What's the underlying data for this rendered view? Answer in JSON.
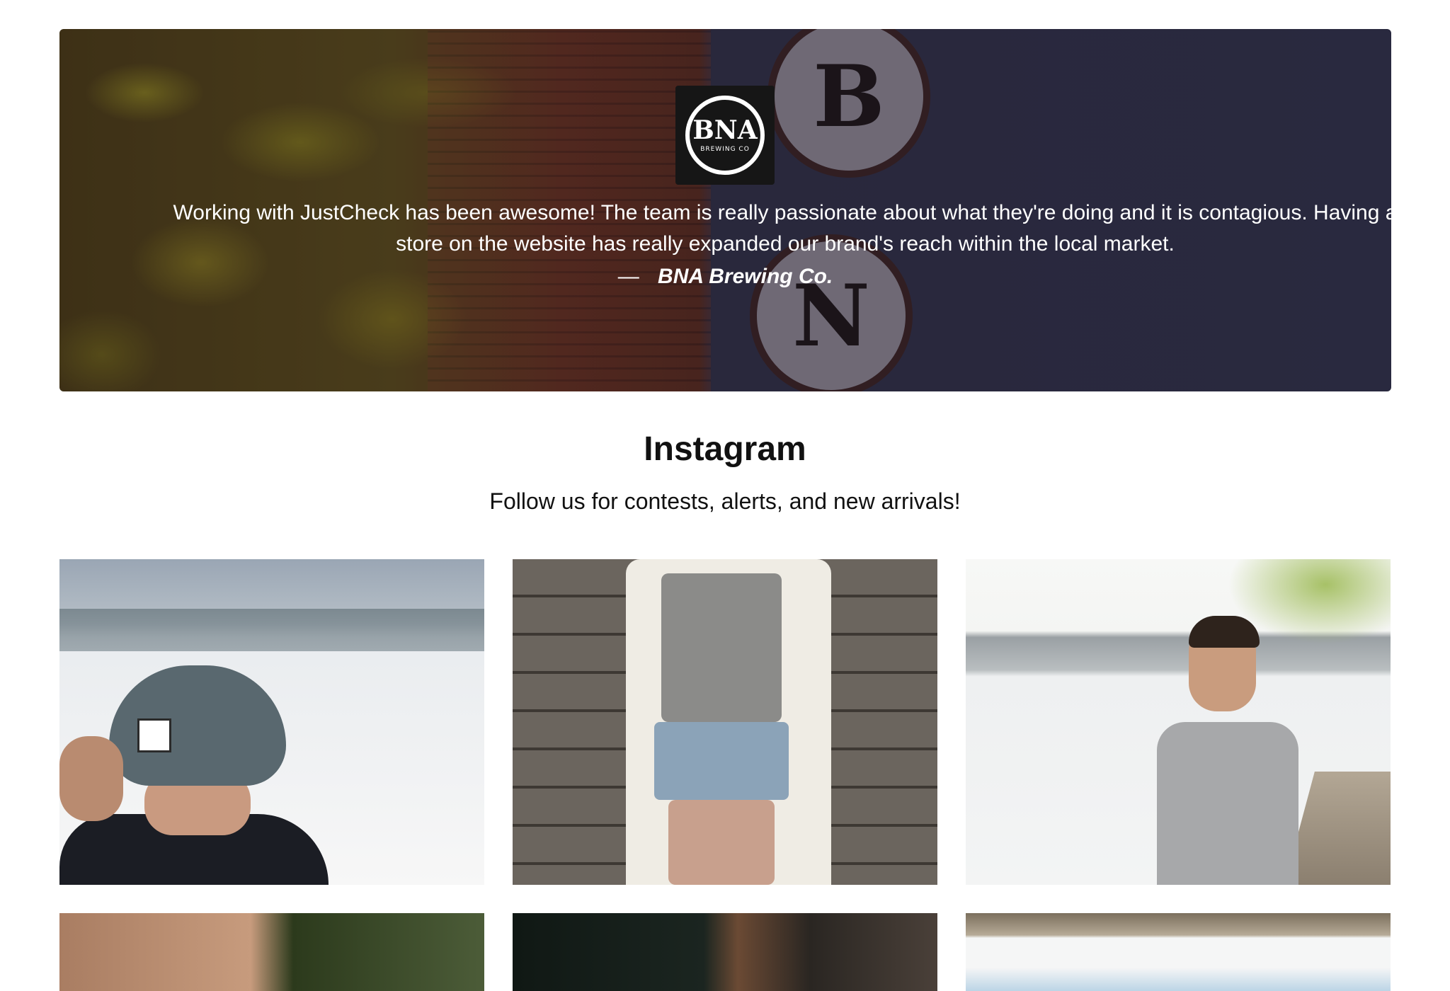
{
  "testimonial": {
    "logo": {
      "main": "BNA",
      "sub": "BREWING CO"
    },
    "sign_letters": [
      "B",
      "N"
    ],
    "quote": "Working with JustCheck has been awesome! The team is really passionate about what they're doing and it is contagious. Having a store on the website has really expanded our brand's reach within the local market.",
    "dash": "—",
    "author": "BNA Brewing Co."
  },
  "instagram": {
    "title": "Instagram",
    "subtitle": "Follow us for contests, alerts, and new arrivals!"
  }
}
